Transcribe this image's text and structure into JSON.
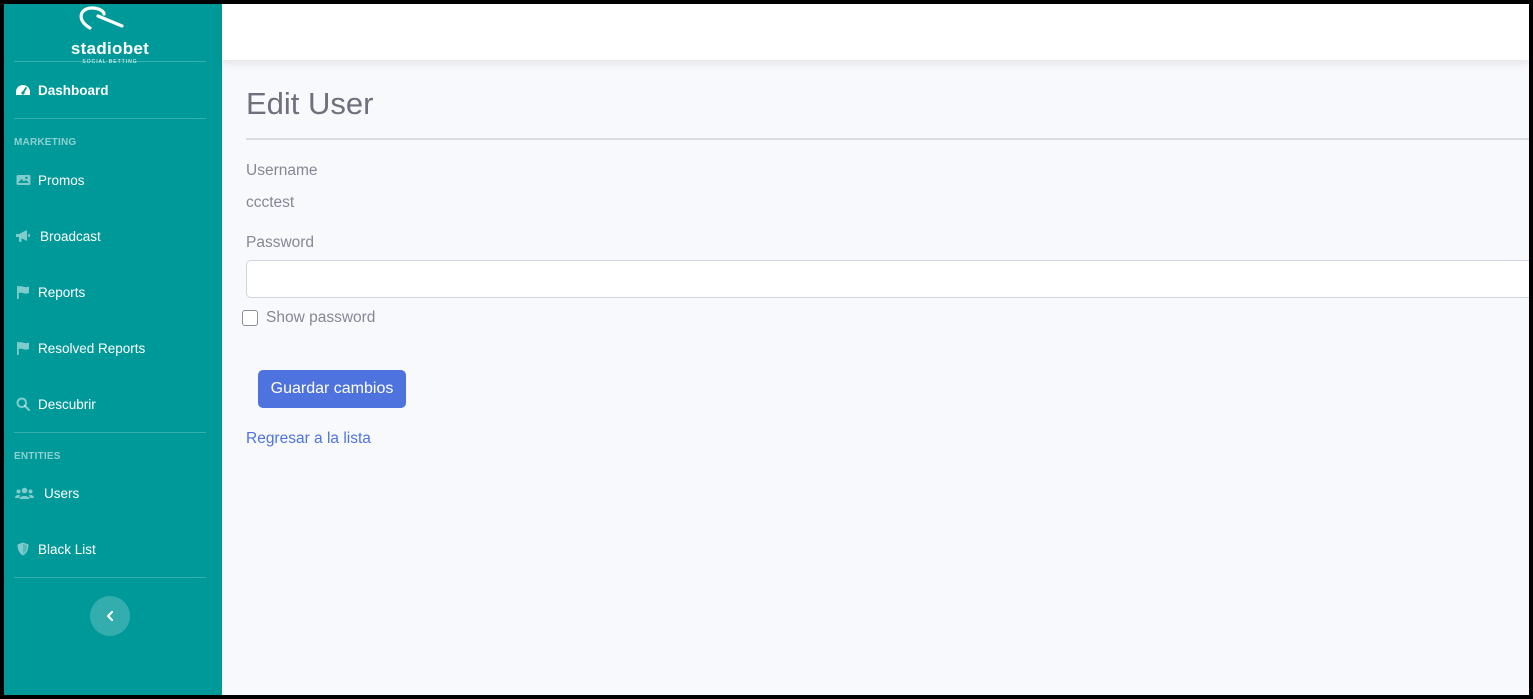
{
  "brand": {
    "name": "stadiobet",
    "tagline": "SOCIAL BETTING"
  },
  "sidebar": {
    "dashboard": {
      "label": "Dashboard",
      "icon": "tachometer-icon"
    },
    "sections": [
      {
        "heading": "MARKETING",
        "items": [
          {
            "label": "Promos",
            "icon": "image-icon"
          },
          {
            "label": "Broadcast",
            "icon": "bullhorn-icon"
          },
          {
            "label": "Reports",
            "icon": "flag-icon"
          },
          {
            "label": "Resolved Reports",
            "icon": "flag-icon"
          },
          {
            "label": "Descubrir",
            "icon": "search-icon"
          }
        ]
      },
      {
        "heading": "ENTITIES",
        "items": [
          {
            "label": "Users",
            "icon": "users-icon"
          },
          {
            "label": "Black List",
            "icon": "shield-icon"
          }
        ]
      }
    ],
    "toggle_icon": "chevron-left-icon"
  },
  "page": {
    "title": "Edit User",
    "username_label": "Username",
    "username_value": "ccctest",
    "password_label": "Password",
    "password_value": "",
    "password_placeholder": "",
    "show_password_label": "Show password",
    "show_password_checked": false,
    "save_button": "Guardar cambios",
    "back_link": "Regresar a la lista"
  },
  "colors": {
    "sidebar": "#009999",
    "primary": "#4e73df",
    "background": "#f8f9fc",
    "text_muted": "#858796"
  }
}
